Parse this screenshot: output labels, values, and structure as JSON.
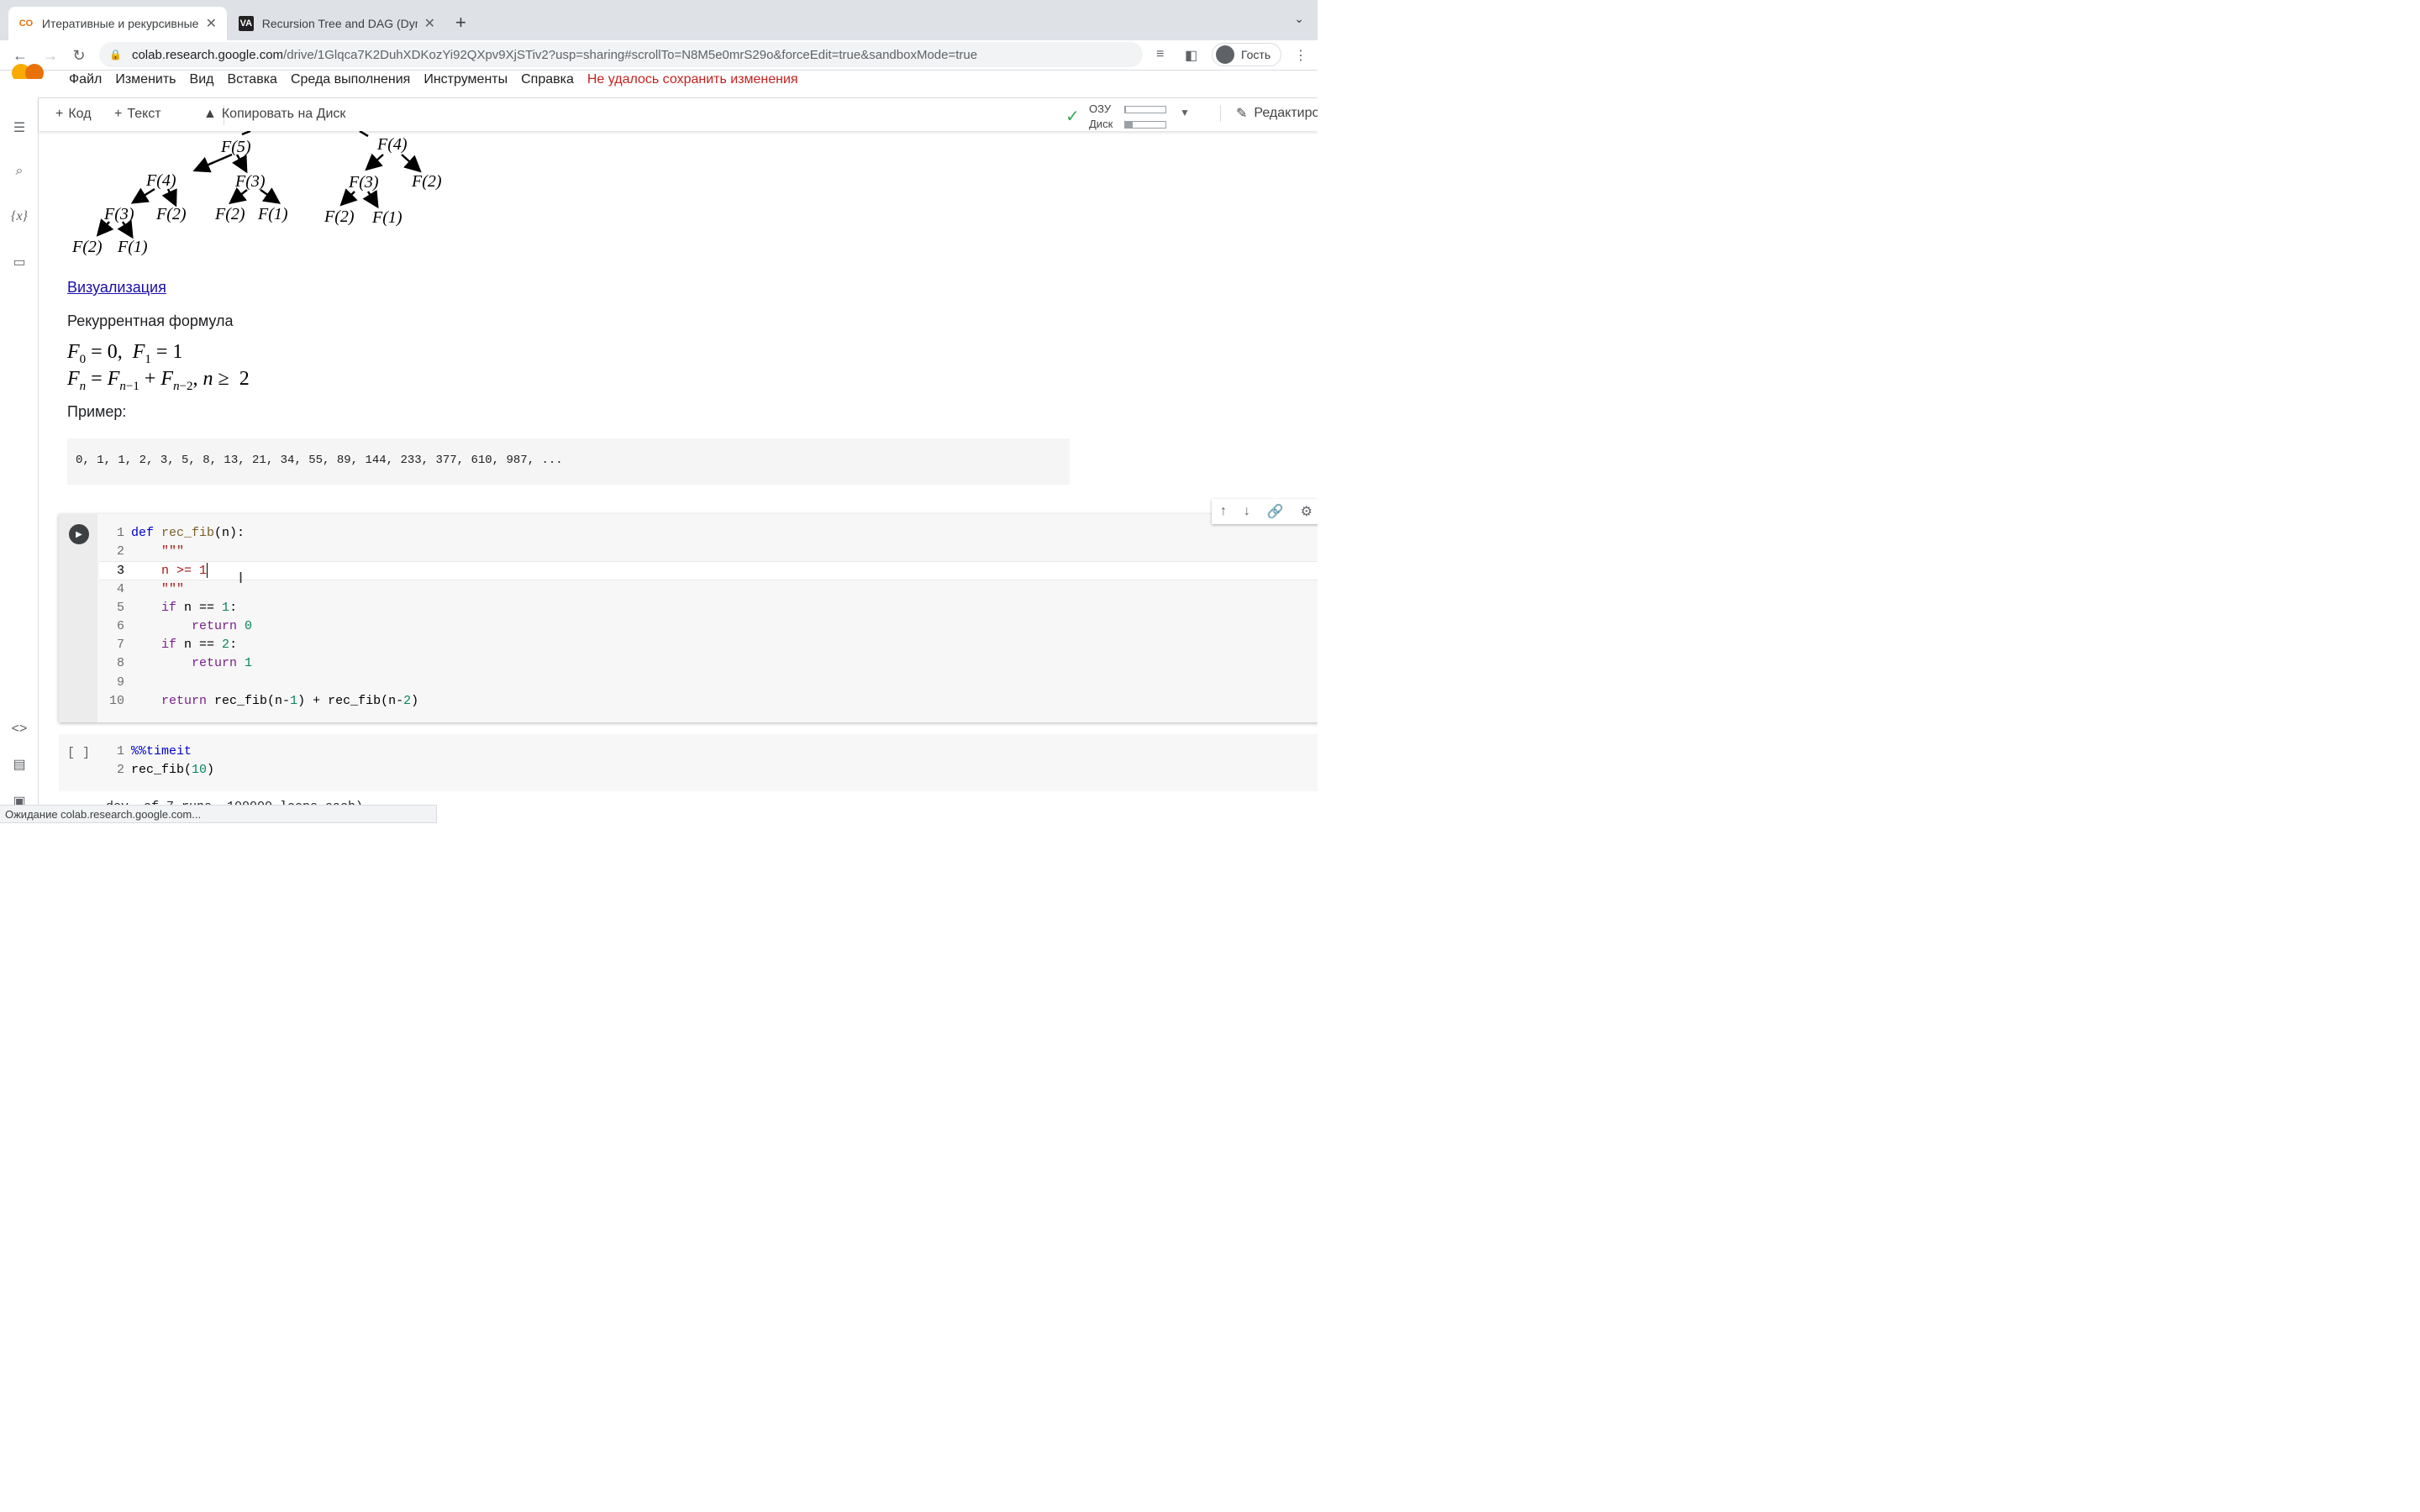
{
  "browser": {
    "tabs": [
      {
        "title": "Итеративные и рекурсивные",
        "favicon": "colab-icon",
        "favicon_color": "#e8710a",
        "active": true
      },
      {
        "title": "Recursion Tree and DAG (Dyna",
        "favicon": "va-icon",
        "active": false
      }
    ],
    "url_host": "colab.research.google.com",
    "url_path": "/drive/1Glqca7K2DuhXDKozYi92QXpv9XjSTiv2?usp=sharing#scrollTo=N8M5e0mrS29o&forceEdit=true&sandboxMode=true",
    "profile_label": "Гость"
  },
  "colab": {
    "menu": [
      "Файл",
      "Изменить",
      "Вид",
      "Вставка",
      "Среда выполнения",
      "Инструменты",
      "Справка"
    ],
    "save_warning": "Не удалось сохранить изменения",
    "toolbar": {
      "add_code": "Код",
      "add_text": "Текст",
      "copy_to_drive": "Копировать на Диск",
      "ram_label": "ОЗУ",
      "disk_label": "Диск",
      "ram_level": 0.02,
      "disk_level": 0.18,
      "edit_label": "Редактиров"
    }
  },
  "tree_nodes": {
    "left": [
      "F(5)",
      "F(4)",
      "F(3)",
      "F(3)",
      "F(2)",
      "F(2)",
      "F(1)",
      "F(2)",
      "F(1)"
    ],
    "right": [
      "F(4)",
      "F(3)",
      "F(2)",
      "F(2)",
      "F(1)"
    ]
  },
  "text": {
    "visualization_link": "Визуализация",
    "formula_title": "Рекуррентная формула",
    "example_title": "Пример:",
    "sequence": "0, 1, 1, 2, 3, 5, 8, 13, 21, 34, 55, 89, 144, 233, 377, 610, 987, ..."
  },
  "cell2": {
    "exec_bracket": "[ ]"
  },
  "output_text": "dev. of 7 runs, 100000 loops each)",
  "status_text": "Ожидание colab.research.google.com...",
  "colors": {
    "accent": "#f9ab00",
    "warning": "#c5221f",
    "link": "#1a0dab",
    "ok": "#34a853"
  }
}
